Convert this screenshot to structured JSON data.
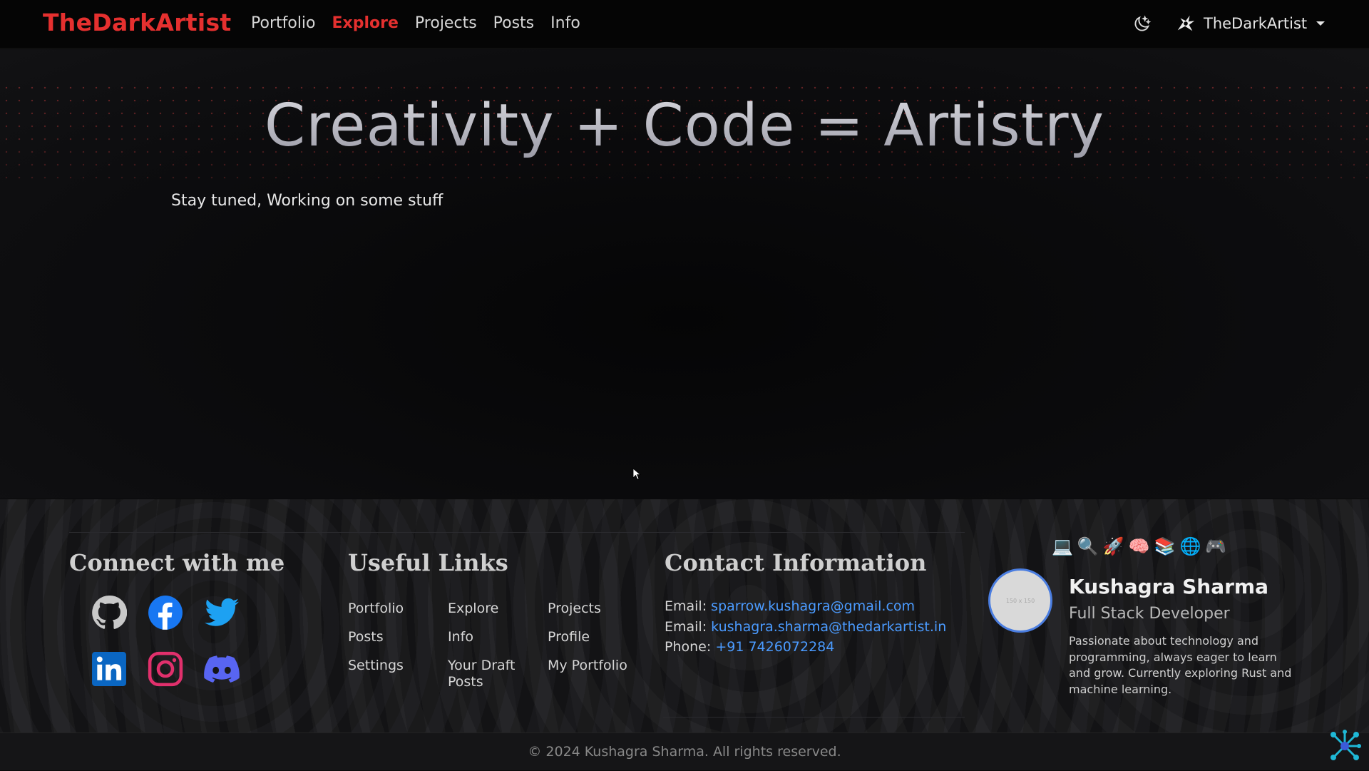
{
  "navbar": {
    "brand": "TheDarkArtist",
    "links": [
      {
        "label": "Portfolio",
        "active": false
      },
      {
        "label": "Explore",
        "active": true
      },
      {
        "label": "Projects",
        "active": false
      },
      {
        "label": "Posts",
        "active": false
      },
      {
        "label": "Info",
        "active": false
      }
    ],
    "theme_icon": "moon-stars-icon",
    "user": {
      "name": "TheDarkArtist",
      "logo": "artist-logo-icon",
      "caret": "caret-down-icon"
    }
  },
  "hero": {
    "title": "Creativity + Code = Artistry",
    "subtitle": "Stay tuned, Working on some stuff"
  },
  "footer": {
    "connect": {
      "heading": "Connect with me",
      "socials": [
        {
          "name": "github",
          "icon": "github-icon",
          "color": "#cccccc"
        },
        {
          "name": "facebook",
          "icon": "facebook-icon",
          "color": "#1877f2"
        },
        {
          "name": "twitter",
          "icon": "twitter-icon",
          "color": "#1da1f2"
        },
        {
          "name": "linkedin",
          "icon": "linkedin-icon",
          "color": "#0a66c2"
        },
        {
          "name": "instagram",
          "icon": "instagram-icon",
          "color": "#e1306c"
        },
        {
          "name": "discord",
          "icon": "discord-icon",
          "color": "#5865f2"
        }
      ]
    },
    "useful_links": {
      "heading": "Useful Links",
      "items": [
        "Portfolio",
        "Explore",
        "Projects",
        "Posts",
        "Info",
        "Profile",
        "Settings",
        "Your Draft Posts",
        "My Portfolio"
      ]
    },
    "contact": {
      "heading": "Contact Information",
      "email1_label": "Email:",
      "email1": "sparrow.kushagra@gmail.com",
      "email2_label": "Email:",
      "email2": "kushagra.sharma@thedarkartist.in",
      "phone_label": "Phone:",
      "phone": "+91 7426072284"
    },
    "profile": {
      "emojis": [
        "💻",
        "🔍",
        "🚀",
        "🧠",
        "📚",
        "🌐",
        "🎮"
      ],
      "avatar_placeholder": "150 x 150",
      "name": "Kushagra Sharma",
      "role": "Full Stack Developer",
      "bio": "Passionate about technology and programming, always eager to learn and grow. Currently exploring Rust and machine learning."
    },
    "copyright": "© 2024 Kushagra Sharma. All rights reserved."
  },
  "colors": {
    "accent": "#e5302f",
    "link": "#4b9bff",
    "avatar_ring": "#4a7de0"
  }
}
